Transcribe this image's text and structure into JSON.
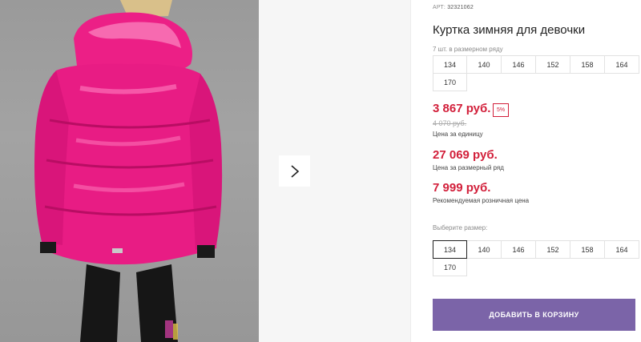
{
  "gallery": {
    "photo_alt": "photo of pink winter jacket, back view",
    "next_icon": "chevron-right-icon"
  },
  "product": {
    "art_label": "АРТ:",
    "art_value": "32321062",
    "title": "Куртка зимняя для девочки",
    "size_row_note": "7 шт. в размерном ряду",
    "size_row": [
      "134",
      "140",
      "146",
      "152",
      "158",
      "164",
      "170"
    ]
  },
  "prices": {
    "main": "3 867 руб.",
    "discount_badge": "5%",
    "old": "4 070 руб.",
    "unit_label": "Цена за единицу",
    "row_price": "27 069 руб.",
    "row_label": "Цена за размерный ряд",
    "rrp": "7 999 руб.",
    "rrp_label": "Рекомендуемая розничная цена"
  },
  "size_select": {
    "label": "Выберите размер:",
    "options": [
      "134",
      "140",
      "146",
      "152",
      "158",
      "164",
      "170"
    ],
    "selected": "134"
  },
  "cart": {
    "button_label": "Добавить в корзину"
  },
  "colors": {
    "price_red": "#d21f3a",
    "cart_purple": "#7b64a8",
    "jacket_pink": "#f0207f"
  }
}
